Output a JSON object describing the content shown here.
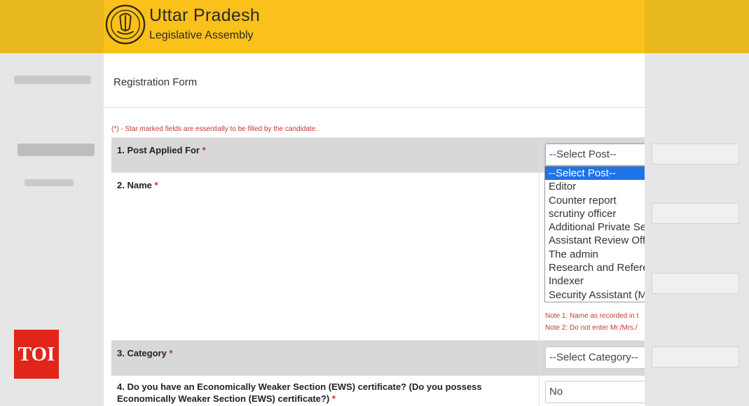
{
  "header": {
    "title": "Uttar Pradesh",
    "subtitle": "Legislative Assembly"
  },
  "form": {
    "title": "Registration Form",
    "star_note": "(*) - Star marked fields are essentially to be filled by the candidate.",
    "required_mark": "*"
  },
  "fields": {
    "post": {
      "label": "1. Post Applied For",
      "value": "--Select Post--"
    },
    "name": {
      "label": "2. Name",
      "note1": "Note 1: Name as recorded in t",
      "note2": "Note 2: Do not enter Mr./Mrs./"
    },
    "category": {
      "label": "3. Category",
      "value": "--Select Category--"
    },
    "ews": {
      "label": "4. Do you have an Economically Weaker Section (EWS) certificate? (Do you possess Economically Weaker Section (EWS) certificate?)",
      "value": "No"
    }
  },
  "post_options": [
    "--Select Post--",
    "Editor",
    "Counter report",
    "scrutiny officer",
    "Additional Private Se",
    "Assistant Review Off",
    "The admin",
    "Research and Refere",
    "Indexer",
    "Security Assistant (M"
  ],
  "watermark": "TOI",
  "colors": {
    "header_bg": "#f9c11a",
    "required": "#c0392b",
    "selected_option": "#1e73e8",
    "row_gray": "#d8d8d8",
    "toi_red": "#e1251b"
  }
}
